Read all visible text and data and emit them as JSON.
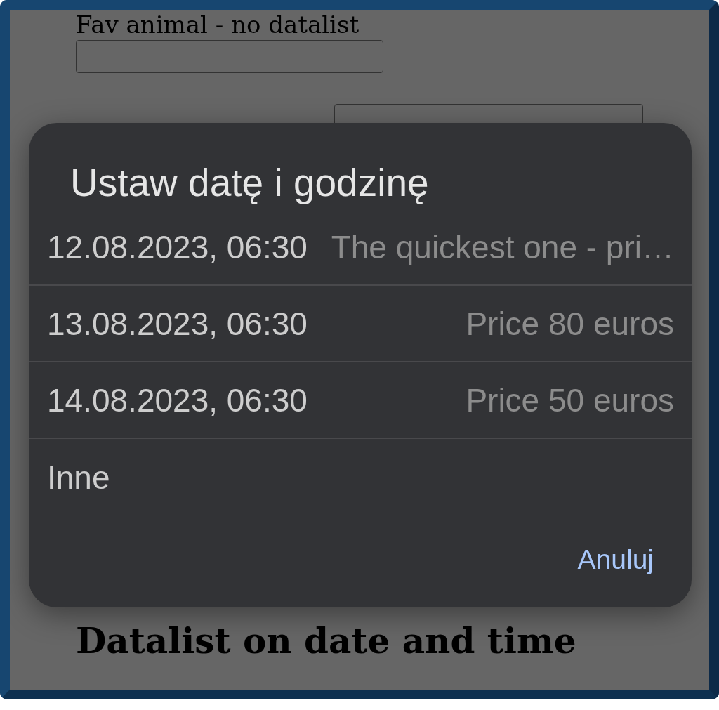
{
  "page": {
    "fields": [
      {
        "label": "Fav animal - no datalist",
        "kind": "stacked"
      },
      {
        "kind": "inline"
      }
    ],
    "heading": "Datalist on date and time"
  },
  "dialog": {
    "title": "Ustaw datę i godzinę",
    "options": [
      {
        "date": "12.08.2023, 06:30",
        "note": "The quickest one - pri…"
      },
      {
        "date": "13.08.2023, 06:30",
        "note": "Price 80 euros"
      },
      {
        "date": "14.08.2023, 06:30",
        "note": "Price 50 euros"
      }
    ],
    "other": "Inne",
    "cancel": "Anuluj"
  }
}
